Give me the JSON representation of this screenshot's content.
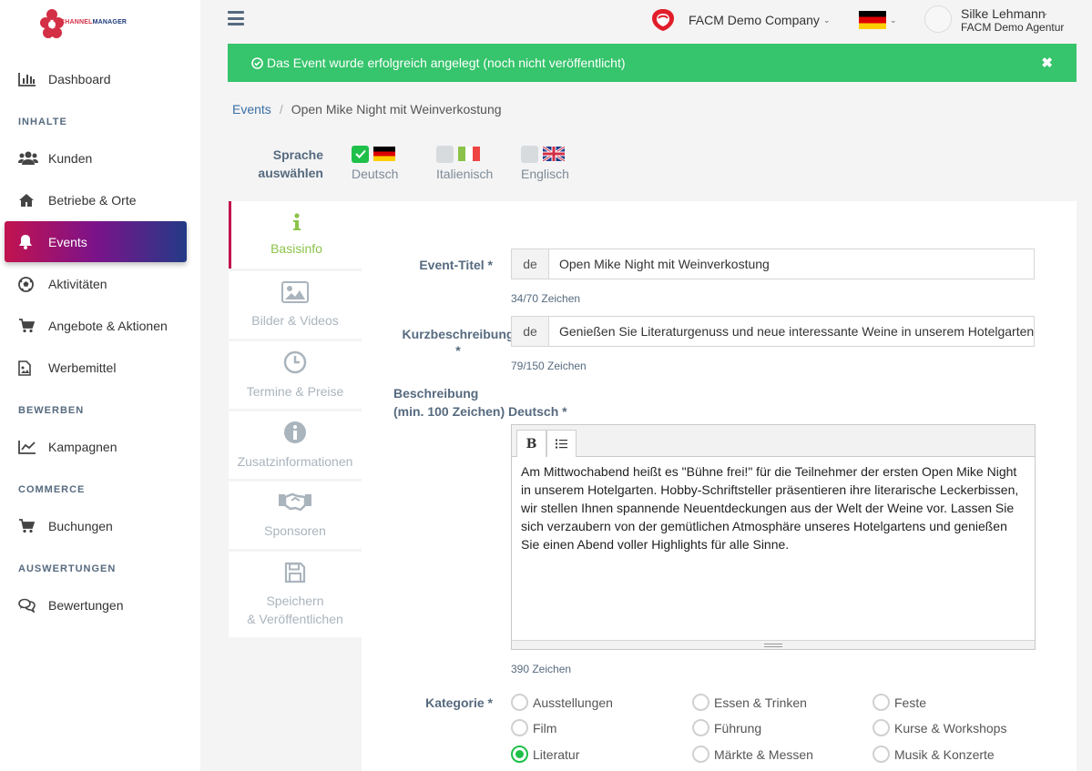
{
  "logo": {
    "text_part1": "CHANNEL",
    "text_part2": "MANAGER"
  },
  "sidebar": {
    "items": [
      {
        "label": "Dashboard",
        "icon": "bar-chart-icon"
      },
      {
        "label": "Kunden",
        "icon": "users-icon"
      },
      {
        "label": "Betriebe & Orte",
        "icon": "home-icon"
      },
      {
        "label": "Events",
        "icon": "bell-icon"
      },
      {
        "label": "Aktivitäten",
        "icon": "soccer-ball-icon"
      },
      {
        "label": "Angebote & Aktionen",
        "icon": "cart-icon"
      },
      {
        "label": "Werbemittel",
        "icon": "image-file-icon"
      },
      {
        "label": "Kampagnen",
        "icon": "line-chart-icon"
      },
      {
        "label": "Buchungen",
        "icon": "cart-icon"
      },
      {
        "label": "Bewertungen",
        "icon": "comments-icon"
      }
    ],
    "sections": {
      "inhalte": "INHALTE",
      "bewerben": "BEWERBEN",
      "commerce": "COMMERCE",
      "auswertungen": "AUSWERTUNGEN"
    }
  },
  "header": {
    "company": "FACM Demo Company",
    "user_name": "Silke Lehmann",
    "user_org": "FACM Demo Agentur"
  },
  "alert": {
    "message": "Das Event wurde erfolgreich angelegt (noch nicht veröffentlicht)",
    "close": "✖",
    "color": "#36c46c"
  },
  "breadcrumb": {
    "parent": "Events",
    "current": "Open Mike Night mit Weinverkostung"
  },
  "language_select": {
    "label_line1": "Sprache",
    "label_line2": "auswählen",
    "options": [
      {
        "name": "Deutsch",
        "checked": true
      },
      {
        "name": "Italienisch",
        "checked": false
      },
      {
        "name": "Englisch",
        "checked": false
      }
    ]
  },
  "tabs": [
    {
      "label": "Basisinfo",
      "icon": "info-icon",
      "active": true
    },
    {
      "label": "Bilder & Videos",
      "icon": "image-icon",
      "active": false
    },
    {
      "label": "Termine & Preise",
      "icon": "clock-icon",
      "active": false
    },
    {
      "label": "Zusatzinformationen",
      "icon": "info-circle-icon",
      "active": false
    },
    {
      "label": "Sponsoren",
      "icon": "handshake-icon",
      "active": false
    },
    {
      "label_line1": "Speichern",
      "label_line2": "& Veröffentlichen",
      "icon": "save-icon",
      "active": false
    }
  ],
  "form": {
    "title": {
      "label": "Event-Titel *",
      "lang": "de",
      "value": "Open Mike Night mit Weinverkostung",
      "counter": "34/70 Zeichen"
    },
    "short": {
      "label": "Kurzbeschreibung",
      "label_star": "*",
      "lang": "de",
      "value": "Genießen Sie Literaturgenuss und neue interessante Weine in unserem Hotelgarten.",
      "counter": "79/150 Zeichen"
    },
    "description": {
      "label_line1": "Beschreibung",
      "label_line2": "(min. 100 Zeichen) Deutsch *",
      "bold_button": "B",
      "text": "Am Mittwochabend heißt es \"Bühne frei!\" für die Teilnehmer der ersten Open Mike Night in unserem Hotelgarten. Hobby-Schriftsteller präsentieren ihre literarische Leckerbissen, wir stellen Ihnen spannende Neuentdeckungen aus der Welt der Weine vor. Lassen Sie sich verzaubern von der gemütlichen Atmosphäre unseres Hotelgartens und genießen Sie einen Abend voller Highlights für alle Sinne.",
      "counter": "390 Zeichen"
    },
    "category": {
      "label": "Kategorie *",
      "options": [
        {
          "name": "Ausstellungen",
          "checked": false
        },
        {
          "name": "Essen & Trinken",
          "checked": false
        },
        {
          "name": "Feste",
          "checked": false
        },
        {
          "name": "Film",
          "checked": false
        },
        {
          "name": "Führung",
          "checked": false
        },
        {
          "name": "Kurse & Workshops",
          "checked": false
        },
        {
          "name": "Literatur",
          "checked": true
        },
        {
          "name": "Märkte & Messen",
          "checked": false
        },
        {
          "name": "Musik & Konzerte",
          "checked": false
        }
      ]
    }
  },
  "colors": {
    "accent": "#c2134f",
    "success": "#1ec04a",
    "label": "#566a7f"
  }
}
